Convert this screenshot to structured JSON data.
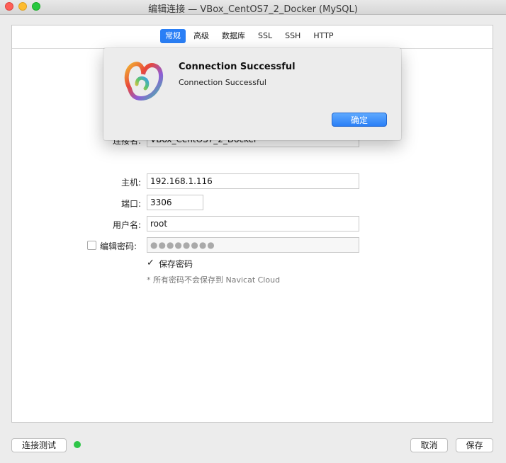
{
  "window": {
    "title": "编辑连接 — VBox_CentOS7_2_Docker (MySQL)"
  },
  "tabs": [
    {
      "label": "常规",
      "active": true
    },
    {
      "label": "高级",
      "active": false
    },
    {
      "label": "数据库",
      "active": false
    },
    {
      "label": "SSL",
      "active": false
    },
    {
      "label": "SSH",
      "active": false
    },
    {
      "label": "HTTP",
      "active": false
    }
  ],
  "form": {
    "connection_name_label": "连接名:",
    "connection_name_value": "VBox_CentOS7_2_Docker",
    "host_label": "主机:",
    "host_value": "192.168.1.116",
    "port_label": "端口:",
    "port_value": "3306",
    "username_label": "用户名:",
    "username_value": "root",
    "edit_password_label": "编辑密码:",
    "password_mask": "●●●●●●●●",
    "save_password_label": "保存密码",
    "note": "* 所有密码不会保存到 Navicat Cloud"
  },
  "alert": {
    "title": "Connection Successful",
    "message": "Connection Successful",
    "ok_label": "确定",
    "icon": "navicat-logo-icon"
  },
  "footer": {
    "test_label": "连接测试",
    "cancel_label": "取消",
    "save_label": "保存",
    "status_color": "#2ec548"
  }
}
